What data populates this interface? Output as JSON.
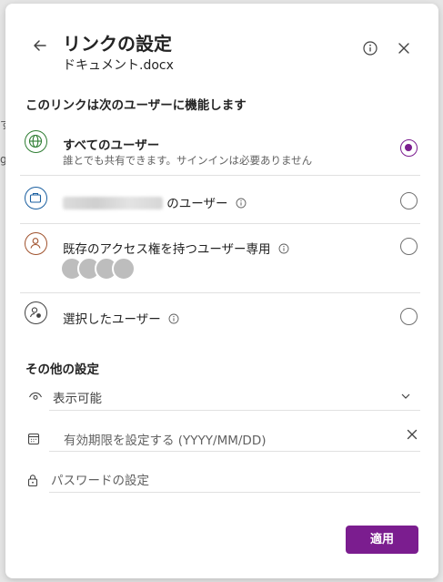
{
  "dialog": {
    "title": "リンクの設定",
    "subtitle": "ドキュメント.docx"
  },
  "audience": {
    "heading": "このリンクは次のユーザーに機能します",
    "options": [
      {
        "label": "すべてのユーザー",
        "description": "誰とでも共有できます。サインインは必要ありません",
        "selected": true,
        "icon": "globe-icon"
      },
      {
        "label_suffix": "のユーザー",
        "selected": false,
        "icon": "briefcase-icon"
      },
      {
        "label": "既存のアクセス権を持つユーザー専用",
        "selected": false,
        "icon": "person-icon"
      },
      {
        "label": "選択したユーザー",
        "selected": false,
        "icon": "person-settings-icon"
      }
    ]
  },
  "other": {
    "heading": "その他の設定",
    "permission": "表示可能",
    "expiry_placeholder": "有効期限を設定する (YYYY/MM/DD)",
    "password_placeholder": "パスワードの設定"
  },
  "footer": {
    "apply_label": "適用"
  },
  "colors": {
    "accent": "#7b1d8f",
    "globe": "#2e7d32",
    "briefcase": "#1a5fa0",
    "person": "#a0522d"
  }
}
